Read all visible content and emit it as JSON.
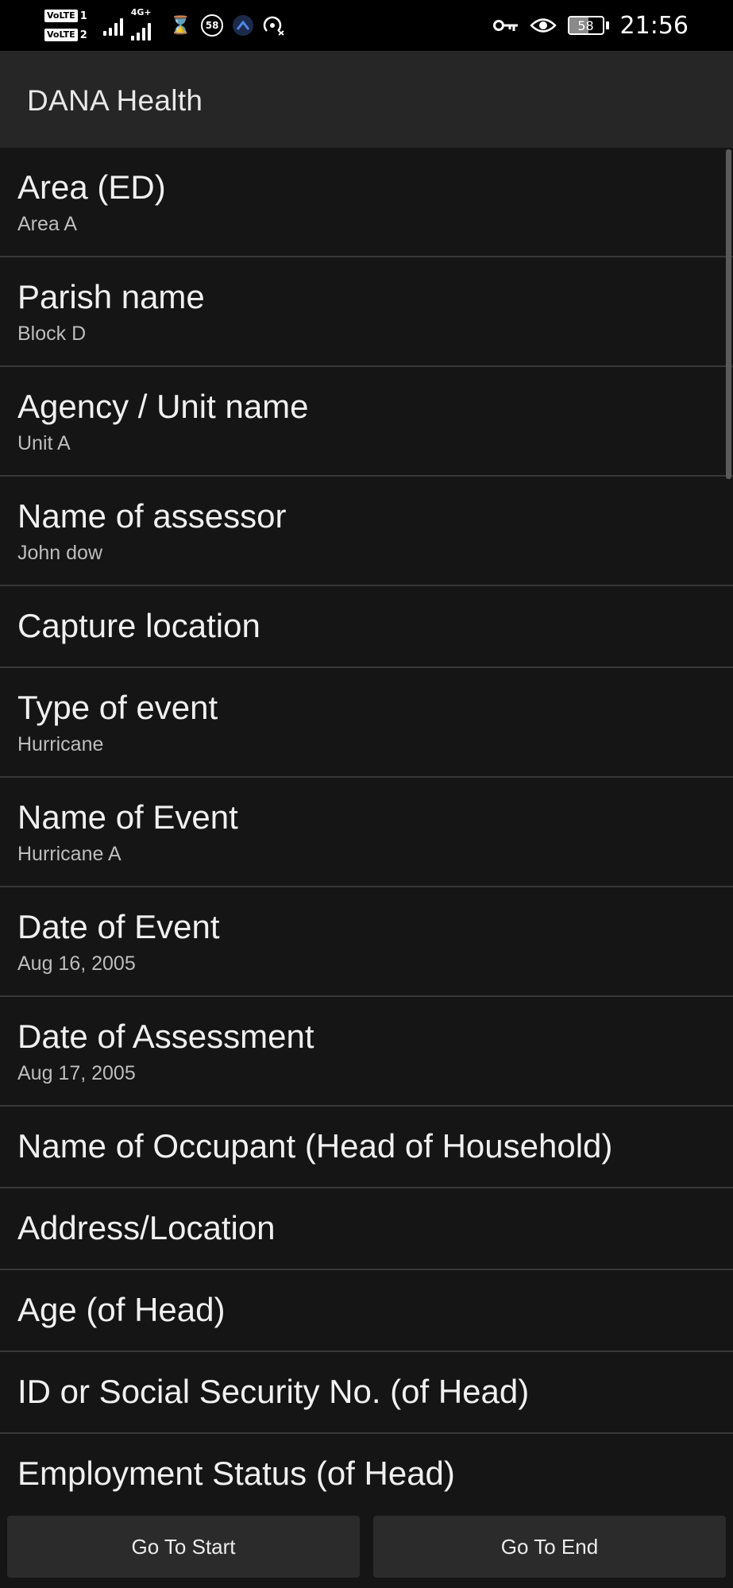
{
  "status_bar": {
    "sim1_label": "VoLTE",
    "sim1_number": "1",
    "sim2_label": "VoLTE",
    "sim2_number": "2",
    "network_type": "4G+",
    "notification_badge": "58",
    "battery_level": "58",
    "battery_fraction": 0.58,
    "time": "21:56",
    "icons": [
      "signal-bars-icon",
      "hourglass-icon",
      "circle-58-icon",
      "app-notification-icon",
      "hotspot-icon",
      "key-icon",
      "eye-icon",
      "battery-icon"
    ]
  },
  "app_bar": {
    "title": "DANA Health"
  },
  "list": {
    "items": [
      {
        "title": "Area (ED)",
        "value": "Area A"
      },
      {
        "title": "Parish name",
        "value": "Block D"
      },
      {
        "title": "Agency / Unit name",
        "value": "Unit A"
      },
      {
        "title": "Name of assessor",
        "value": "John dow"
      },
      {
        "title": "Capture location",
        "value": ""
      },
      {
        "title": "Type of event",
        "value": "Hurricane"
      },
      {
        "title": "Name of Event",
        "value": "Hurricane A"
      },
      {
        "title": "Date of Event",
        "value": "Aug 16, 2005"
      },
      {
        "title": "Date of Assessment",
        "value": "Aug 17, 2005"
      },
      {
        "title": "Name of Occupant (Head of Household)",
        "value": ""
      },
      {
        "title": "Address/Location",
        "value": ""
      },
      {
        "title": "Age (of Head)",
        "value": ""
      },
      {
        "title": "ID or Social Security No. (of Head)",
        "value": ""
      },
      {
        "title": "Employment Status (of Head)",
        "value": ""
      }
    ]
  },
  "bottom_bar": {
    "start_label": "Go To Start",
    "end_label": "Go To End"
  },
  "colors": {
    "background": "#151515",
    "app_bar": "#262626",
    "divider": "#383838",
    "button": "#2b2b2b",
    "title_text": "#f0f0f0",
    "value_text": "#bdbdbd"
  }
}
